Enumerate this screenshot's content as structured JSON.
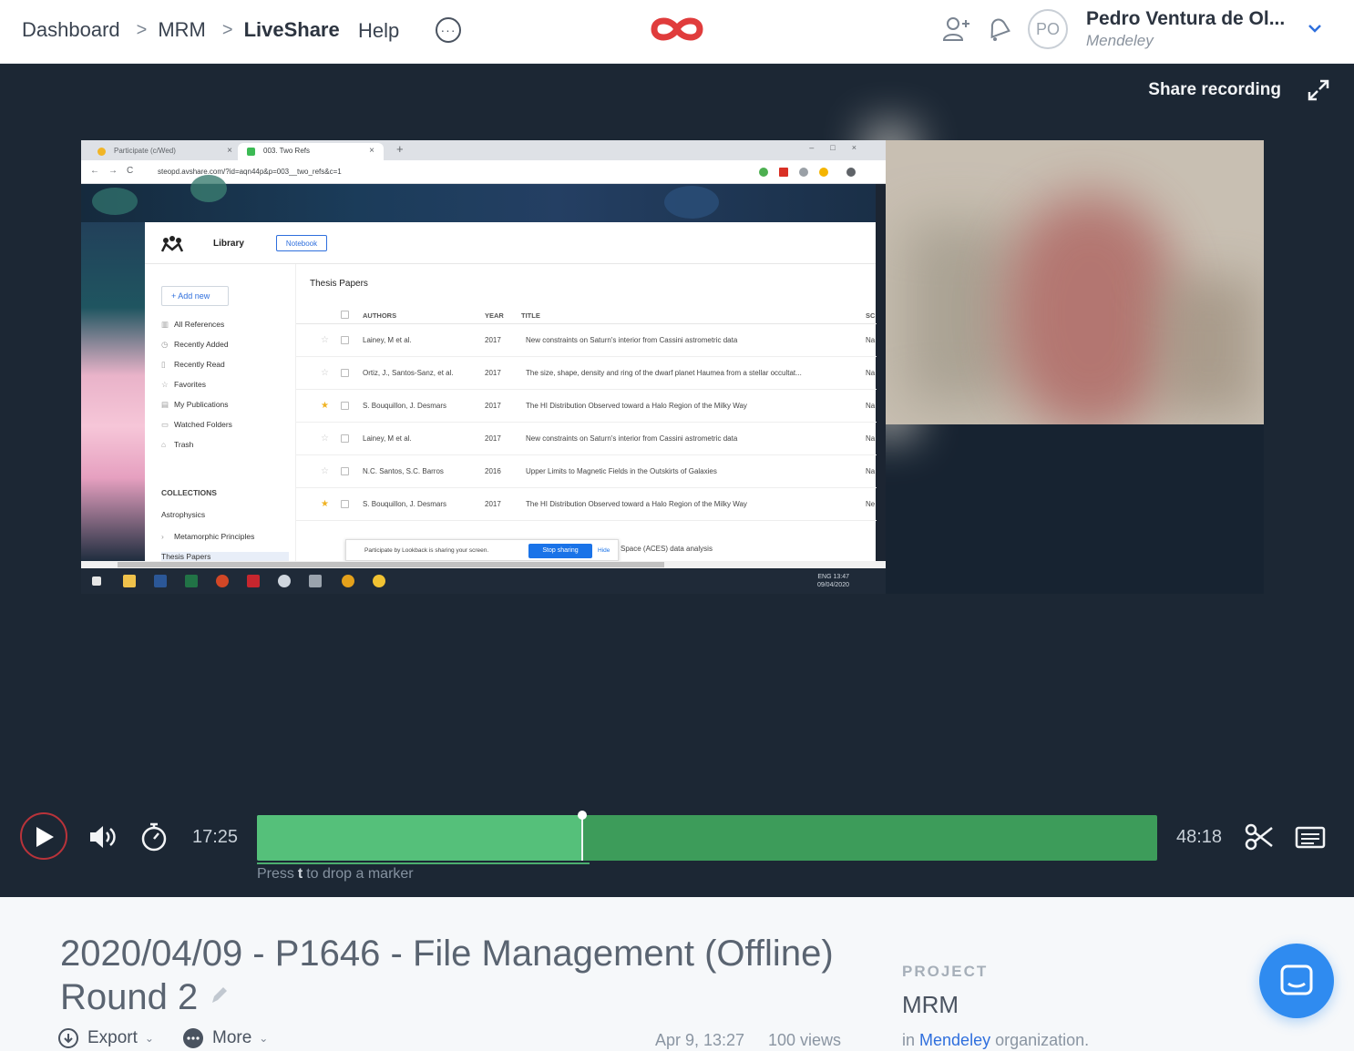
{
  "nav": {
    "crumbs": [
      "Dashboard",
      "MRM",
      "LiveShare"
    ],
    "help": "Help",
    "more_glyph": "···",
    "brand_color": "#e03c3c"
  },
  "user": {
    "initials": "PO",
    "name": "Pedro Ventura de Ol...",
    "org": "Mendeley"
  },
  "player": {
    "share_label": "Share recording",
    "current_time": "17:25",
    "total_time": "48:18",
    "progress_fraction": 0.362,
    "marker_hint_prefix": "Press",
    "marker_hint_key": "t",
    "marker_hint_suffix": "to drop a marker",
    "track_color": "#3d9c5a",
    "played_color": "#55c07a"
  },
  "shared_screen": {
    "tabs": [
      "Participate (c/Wed)",
      "003. Two Refs"
    ],
    "url": "steopd.avshare.com/?id=aqn44p&p=003__two_refs&c=1",
    "app_title": "Library",
    "notebook_btn": "Notebook",
    "add_new": "+ Add new",
    "sidebar": [
      "All References",
      "Recently Added",
      "Recently Read",
      "Favorites",
      "My Publications",
      "Watched Folders",
      "Trash"
    ],
    "collections_label": "COLLECTIONS",
    "collections": [
      "Astrophysics",
      "Metamorphic Principles",
      "Thesis Papers"
    ],
    "folder_title": "Thesis Papers",
    "columns": [
      "AUTHORS",
      "YEAR",
      "TITLE",
      "SC"
    ],
    "rows": [
      {
        "star": false,
        "authors": "Lainey, M et al.",
        "year": "2017",
        "title": "New constraints on Saturn's interior from Cassini astrometric data",
        "src": "Na"
      },
      {
        "star": false,
        "authors": "Ortiz, J., Santos-Sanz, et al.",
        "year": "2017",
        "title": "The size, shape, density and ring of the dwarf planet Haumea from a stellar occultat...",
        "src": "Na"
      },
      {
        "star": true,
        "authors": "S. Bouquillon, J. Desmars",
        "year": "2017",
        "title": "The HI Distribution Observed toward a Halo Region of the Milky Way",
        "src": "Na"
      },
      {
        "star": false,
        "authors": "Lainey, M et al.",
        "year": "2017",
        "title": "New constraints on Saturn's interior from Cassini astrometric data",
        "src": "Na"
      },
      {
        "star": false,
        "authors": "N.C. Santos, S.C. Barros",
        "year": "2016",
        "title": "Upper Limits to Magnetic Fields in the Outskirts of Galaxies",
        "src": "Na"
      },
      {
        "star": true,
        "authors": "S. Bouquillon, J. Desmars",
        "year": "2017",
        "title": "The HI Distribution Observed toward a Halo Region of the Milky Way",
        "src": "Ne"
      }
    ],
    "share_toast": "Participate by Lookback is sharing your screen.",
    "stop_sharing": "Stop sharing",
    "hide": "Hide",
    "toast_after": "Space (ACES) data analysis",
    "tray_time": "13:47",
    "tray_date": "09/04/2020",
    "tray_lang": "ENG"
  },
  "recording": {
    "title": "2020/04/09 - P1646 - File Management (Offline) Round 2",
    "export": "Export",
    "more": "More",
    "date": "Apr 9, 13:27",
    "views": "100 views"
  },
  "project": {
    "label": "PROJECT",
    "name": "MRM",
    "org_prefix": "in",
    "org_link": "Mendeley",
    "org_suffix": "organization."
  }
}
